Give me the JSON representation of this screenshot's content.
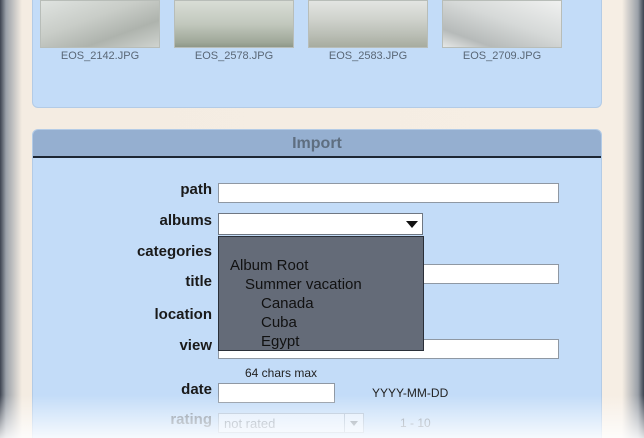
{
  "thumbnails": [
    {
      "filename": "EOS_2142.JPG"
    },
    {
      "filename": "EOS_2578.JPG"
    },
    {
      "filename": "EOS_2583.JPG"
    },
    {
      "filename": "EOS_2709.JPG"
    }
  ],
  "import": {
    "title": "Import",
    "fields": {
      "path": {
        "label": "path",
        "value": ""
      },
      "albums": {
        "label": "albums",
        "selected": ""
      },
      "categories": {
        "label": "categories"
      },
      "title": {
        "label": "title",
        "value": ""
      },
      "location": {
        "label": "location"
      },
      "view": {
        "label": "view",
        "value": "",
        "hint": "64 chars max"
      },
      "date": {
        "label": "date",
        "value": "",
        "format_hint": "YYYY-MM-DD"
      },
      "rating": {
        "label": "rating",
        "selected": "not rated",
        "range_hint": "1 - 10"
      }
    },
    "album_options": [
      {
        "label": "Album Root",
        "level": 0
      },
      {
        "label": "Summer vacation",
        "level": 1
      },
      {
        "label": "Canada",
        "level": 2
      },
      {
        "label": "Cuba",
        "level": 2
      },
      {
        "label": "Egypt",
        "level": 2
      }
    ]
  }
}
